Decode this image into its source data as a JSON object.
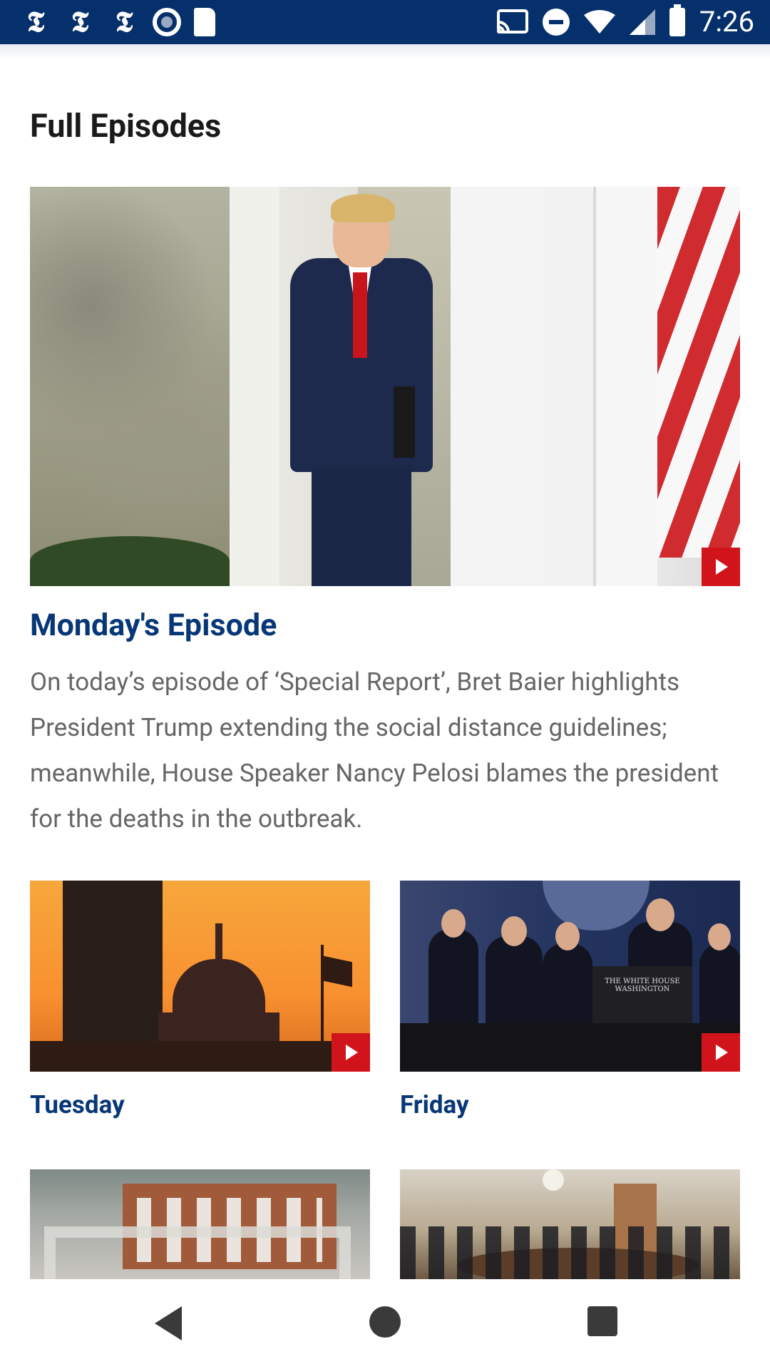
{
  "status_bar": {
    "time": "7:26",
    "left_icons": [
      "nyt-icon",
      "nyt-icon",
      "nyt-icon",
      "record-icon",
      "sd-card-icon"
    ],
    "right_icons": [
      "cast-icon",
      "do-not-disturb-icon",
      "wifi-icon",
      "signal-icon",
      "battery-icon"
    ],
    "nyt_glyph": "𝕿"
  },
  "page": {
    "title": "Full Episodes"
  },
  "featured": {
    "title": "Monday's Episode",
    "description": "On today’s episode of ‘Special Report’, Bret Baier highlights President Trump extending the social distance guidelines; meanwhile, House Speaker Nancy Pelosi blames the president for the deaths in the outbreak."
  },
  "episodes": [
    {
      "label": "Tuesday"
    },
    {
      "label": "Friday"
    },
    {
      "label": ""
    },
    {
      "label": ""
    }
  ],
  "podium_text": "THE WHITE HOUSE\nWASHINGTON",
  "colors": {
    "status_bar": "#06306b",
    "accent_blue": "#073776",
    "play_red": "#d1141b"
  },
  "nav_bar": {
    "icons": [
      "back-icon",
      "home-icon",
      "recents-icon"
    ]
  }
}
